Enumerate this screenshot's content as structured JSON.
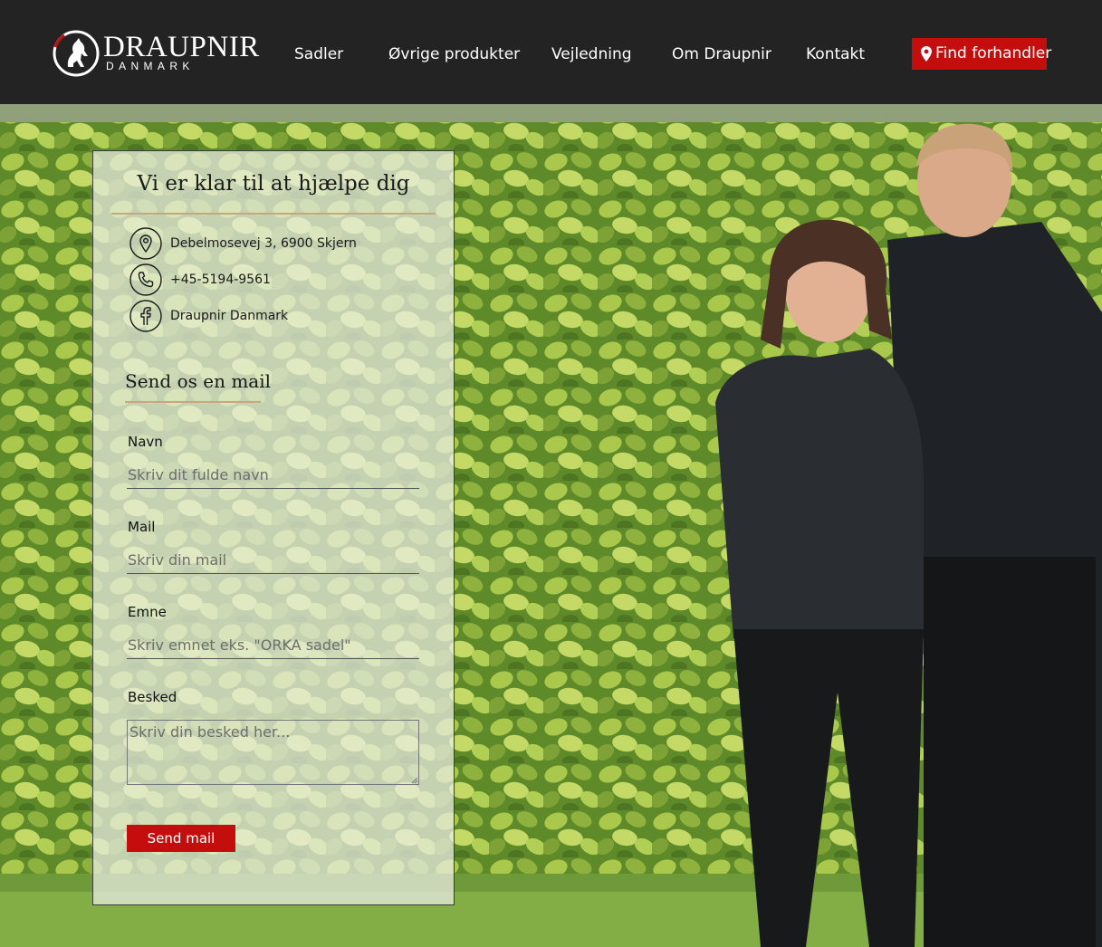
{
  "brand": {
    "name": "DRAUPNIR",
    "sub": "DANMARK"
  },
  "nav": {
    "items": [
      "Sadler",
      "Øvrige produkter",
      "Vejledning",
      "Om Draupnir",
      "Kontakt"
    ],
    "cta_label": "Find forhandler"
  },
  "contact": {
    "title": "Vi er klar til at hjælpe dig",
    "address": "Debelmosevej 3, 6900 Skjern",
    "phone": "+45-5194-9561",
    "facebook": "Draupnir Danmark"
  },
  "form": {
    "heading": "Send os en mail",
    "name_label": "Navn",
    "name_placeholder": "Skriv dit fulde navn",
    "mail_label": "Mail",
    "mail_placeholder": "Skriv din mail",
    "subject_label": "Emne",
    "subject_placeholder": "Skriv emnet eks. \"ORKA sadel\"",
    "message_label": "Besked",
    "message_placeholder": "Skriv din besked her...",
    "submit_label": "Send mail"
  },
  "colors": {
    "header_bg": "#232323",
    "accent_red": "#c40e0e",
    "rule_gold": "#c9a57a"
  },
  "icons": [
    "logo-emblem-icon",
    "map-pin-icon",
    "location-icon",
    "phone-icon",
    "facebook-icon"
  ]
}
